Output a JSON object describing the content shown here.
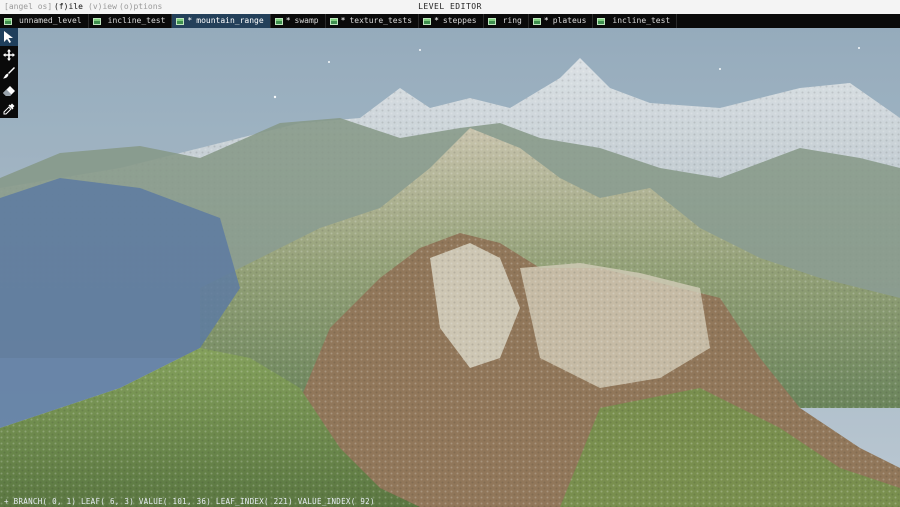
{
  "menu": {
    "os": "[angel os]",
    "file": "(f)ile",
    "view": "(v)iew",
    "options": "(o)ptions",
    "title": "LEVEL EDITOR"
  },
  "tabs": [
    {
      "label": "unnamed_level",
      "dirty": false,
      "active": false
    },
    {
      "label": "incline_test",
      "dirty": false,
      "active": false
    },
    {
      "label": "mountain_range",
      "dirty": true,
      "active": true
    },
    {
      "label": "swamp",
      "dirty": true,
      "active": false
    },
    {
      "label": "texture_tests",
      "dirty": true,
      "active": false
    },
    {
      "label": "steppes",
      "dirty": true,
      "active": false
    },
    {
      "label": "ring",
      "dirty": false,
      "active": false
    },
    {
      "label": "plateus",
      "dirty": true,
      "active": false
    },
    {
      "label": "incline_test",
      "dirty": false,
      "active": false
    }
  ],
  "dirty_marker": "*",
  "tools": [
    {
      "name": "select",
      "icon": "cursor-arrow-icon",
      "active": true
    },
    {
      "name": "move",
      "icon": "move-cross-icon",
      "active": false
    },
    {
      "name": "brush",
      "icon": "brush-icon",
      "active": false
    },
    {
      "name": "eraser",
      "icon": "eraser-icon",
      "active": false
    },
    {
      "name": "eyedropper",
      "icon": "eyedropper-icon",
      "active": false
    }
  ],
  "status": {
    "text": "+ BRANCH( 0, 1) LEAF( 6, 3) VALUE( 101, 36) LEAF_INDEX( 221) VALUE_INDEX( 92)"
  },
  "colors": {
    "tab_active": "#24405a",
    "menubar": "#f4f4f4",
    "toolbar": "#0a0a0a"
  }
}
